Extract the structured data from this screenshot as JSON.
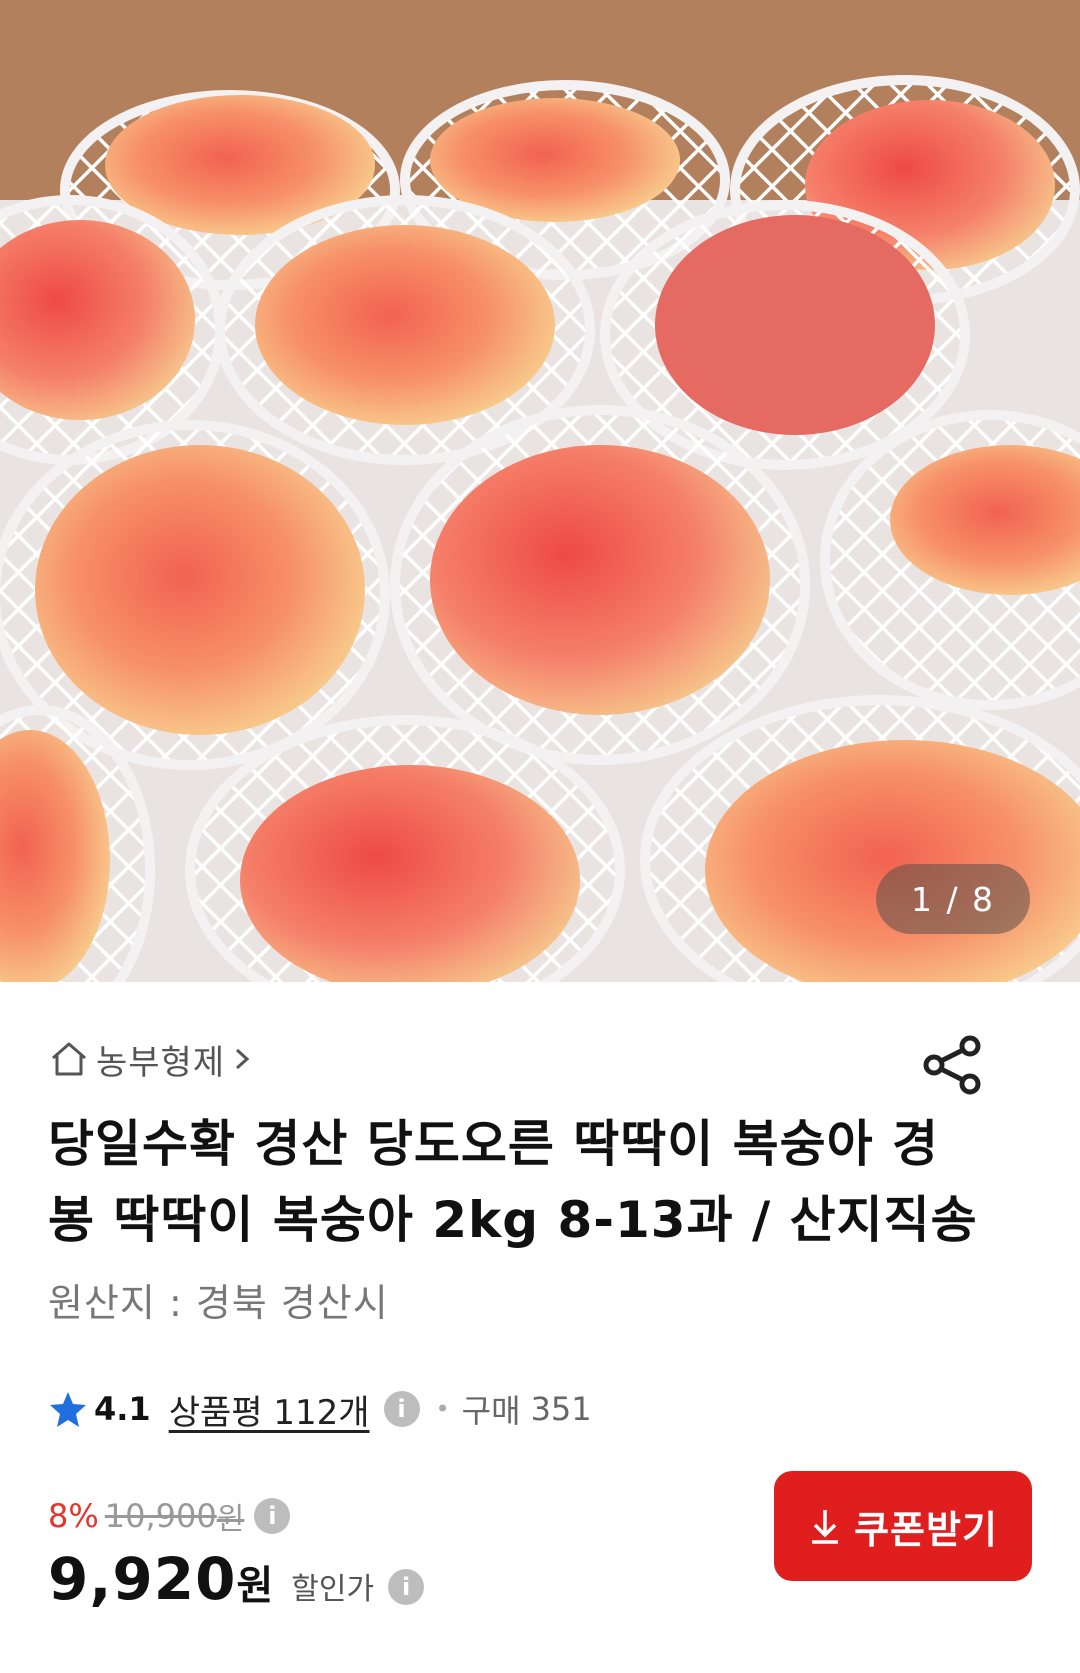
{
  "gallery": {
    "current": "1",
    "total": "8",
    "counter_text": "1 / 8"
  },
  "store": {
    "name": "농부형제",
    "icon": "home-icon"
  },
  "share_icon": "share-icon",
  "product": {
    "title": "당일수확 경산 당도오른 딱딱이 복숭아 경봉 딱딱이 복숭아 2kg 8-13과 / 산지직송",
    "origin": "원산지 : 경북 경산시"
  },
  "rating": {
    "score": "4.1",
    "reviews_label": "상품평 112개",
    "sold_label": "구매",
    "sold_count": "351",
    "star_color": "#1f6fe0"
  },
  "price": {
    "discount": "8%",
    "original": "10,900",
    "original_unit": "원",
    "sale": "9,920",
    "sale_unit": "원",
    "sale_label": "할인가"
  },
  "coupon": {
    "label": "쿠폰받기",
    "color": "#e01e1e"
  }
}
